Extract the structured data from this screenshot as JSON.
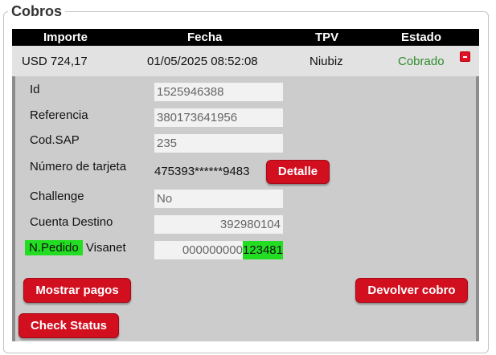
{
  "panel": {
    "title": "Cobros"
  },
  "table": {
    "headers": [
      "Importe",
      "Fecha",
      "TPV",
      "Estado"
    ],
    "row": {
      "importe": "USD 724,17",
      "fecha": "01/05/2025 08:52:08",
      "tpv": "Niubiz",
      "estado": "Cobrado"
    }
  },
  "detail": {
    "id": {
      "label": "Id",
      "value": "1525946388"
    },
    "referencia": {
      "label": "Referencia",
      "value": "380173641956"
    },
    "cod_sap": {
      "label": "Cod.SAP",
      "value": "235"
    },
    "tarjeta": {
      "label": "Número de tarjeta",
      "value": "475393******9483"
    },
    "challenge": {
      "label": "Challenge",
      "value": "No"
    },
    "cuenta_destino": {
      "label": "Cuenta Destino",
      "value": "392980104"
    },
    "pedido": {
      "label_highlight": "N.Pedido",
      "label_rest": " Visanet",
      "value_plain": "000000000",
      "value_highlight": "123481"
    }
  },
  "buttons": {
    "detalle": "Detalle",
    "mostrar_pagos": "Mostrar pagos",
    "devolver_cobro": "Devolver cobro",
    "check_status": "Check Status"
  },
  "colors": {
    "accent": "#d10f1f",
    "estado_ok": "#2e8b2e",
    "highlight": "#22dd22"
  }
}
